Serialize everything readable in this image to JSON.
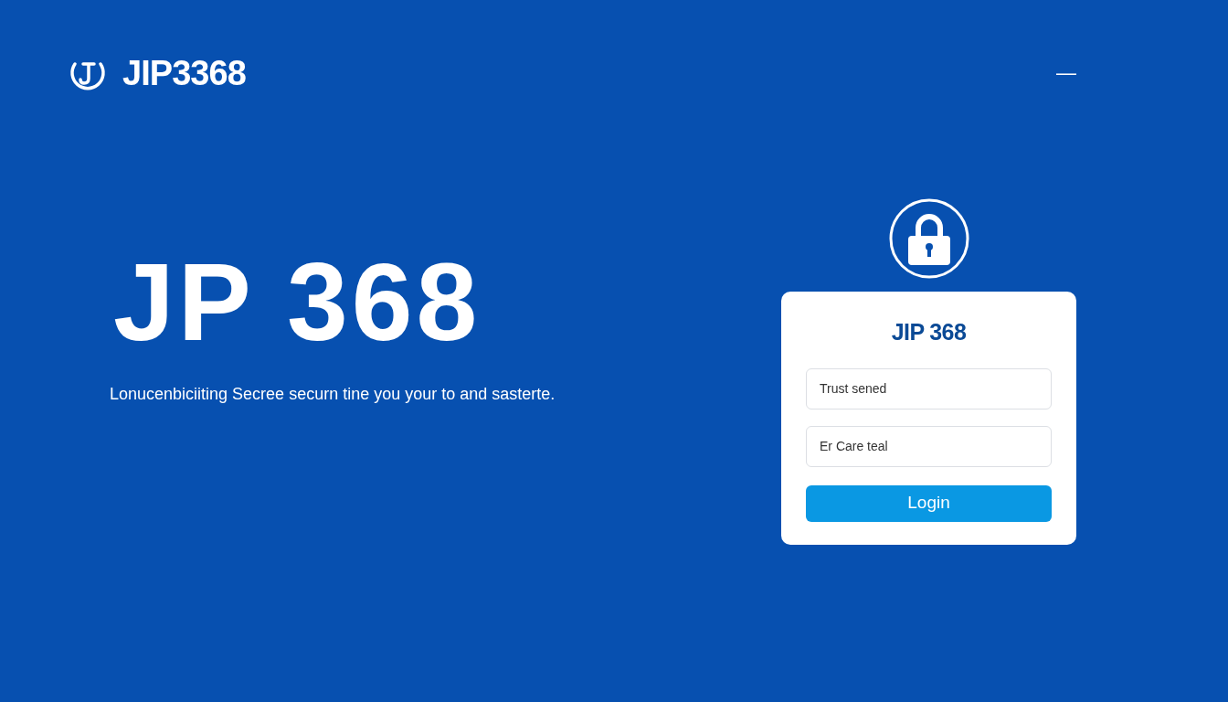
{
  "header": {
    "logo_text": "JIP3368",
    "menu_glyph": "—"
  },
  "hero": {
    "title": "JP 368",
    "tagline": "Lonucenbiciiting Secree securn tine you your to and sasterte."
  },
  "login_card": {
    "title": "JIP 368",
    "fields": [
      {
        "placeholder": "Trust sened"
      },
      {
        "placeholder": "Er Care teal"
      }
    ],
    "button": "Login"
  }
}
